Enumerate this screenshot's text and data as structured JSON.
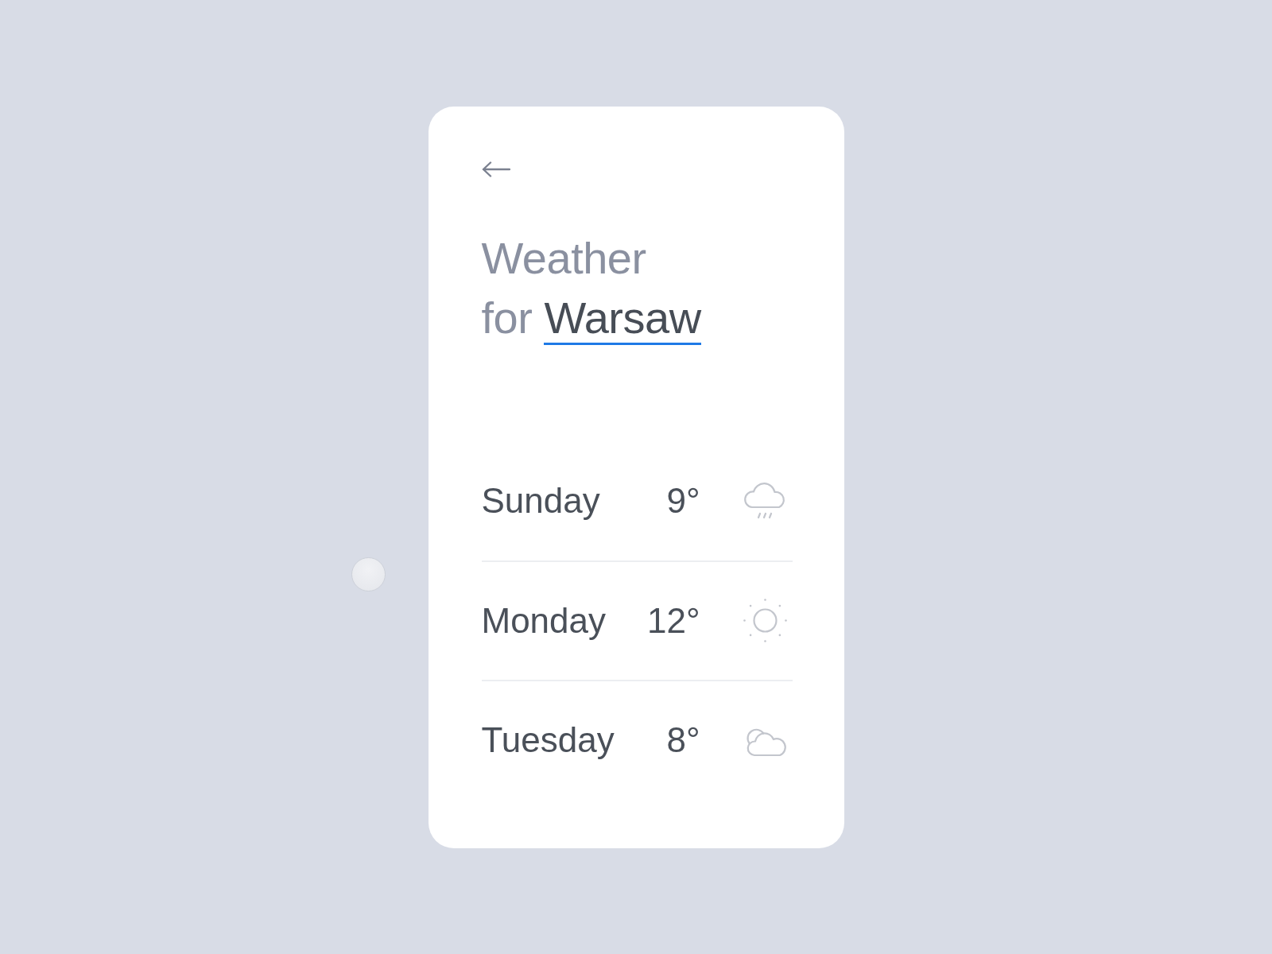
{
  "heading": {
    "line_1": "Weather",
    "line_2": "for",
    "city": "Warsaw"
  },
  "forecast": [
    {
      "day": "Sunday",
      "temperature": "9°",
      "kind": "rain"
    },
    {
      "day": "Monday",
      "temperature": "12°",
      "kind": "sun"
    },
    {
      "day": "Tuesday",
      "temperature": "8°",
      "kind": "cloudy"
    }
  ]
}
